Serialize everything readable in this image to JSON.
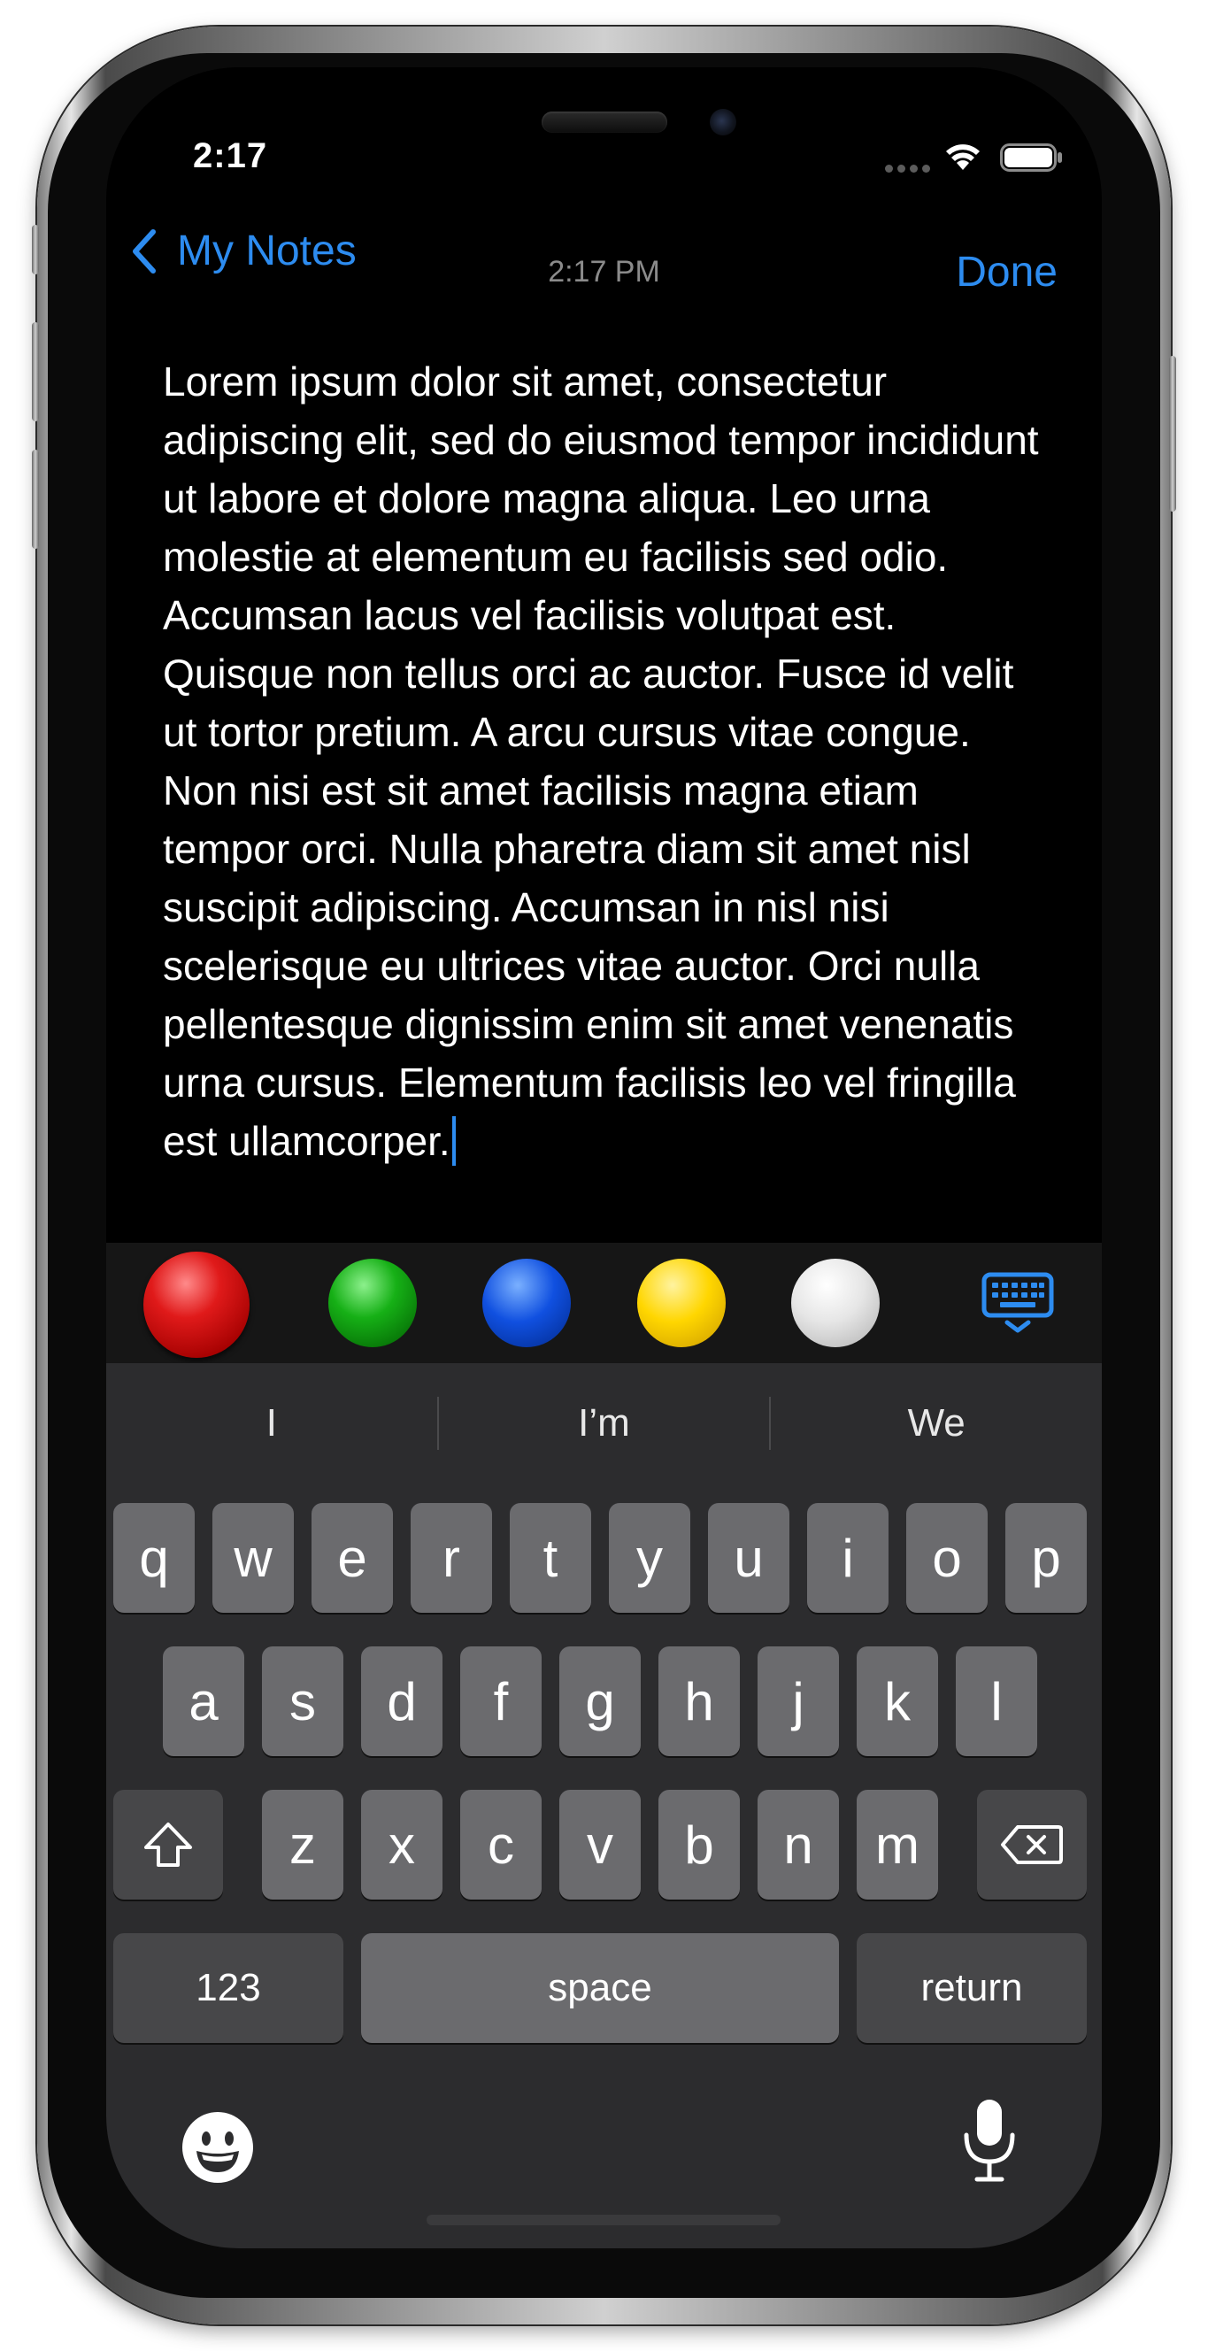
{
  "status_bar": {
    "time": "2:17"
  },
  "nav": {
    "back_label": "My Notes",
    "time": "2:17 PM",
    "done_label": "Done"
  },
  "note": {
    "text": "Lorem ipsum dolor sit amet, consectetur adipiscing elit, sed do eiusmod tempor incididunt ut labore et dolore magna aliqua. Leo urna molestie at elementum eu facilisis sed odio. Accumsan lacus vel facilisis volutpat est. Quisque non tellus orci ac auctor. Fusce id velit ut tortor pretium. A arcu cursus vitae congue. Non nisi est sit amet facilisis magna etiam tempor orci. Nulla pharetra diam sit amet nisl suscipit adipiscing. Accumsan in nisl nisi scelerisque eu ultrices vitae auctor. Orci nulla pellentesque dignissim enim sit amet venenatis urna cursus. Elementum facilisis leo vel fringilla est ullamcorper."
  },
  "toolbar": {
    "colors": [
      {
        "name": "red",
        "hex": "#e01a1a"
      },
      {
        "name": "green",
        "hex": "#16b016"
      },
      {
        "name": "blue",
        "hex": "#1050e0"
      },
      {
        "name": "yellow",
        "hex": "#ffd600"
      },
      {
        "name": "white",
        "hex": "#e6e6e6"
      }
    ],
    "keyboard_icon": "keyboard-dismiss-icon"
  },
  "keyboard": {
    "predictions": [
      "I",
      "I’m",
      "We"
    ],
    "row1": [
      "q",
      "w",
      "e",
      "r",
      "t",
      "y",
      "u",
      "i",
      "o",
      "p"
    ],
    "row2": [
      "a",
      "s",
      "d",
      "f",
      "g",
      "h",
      "j",
      "k",
      "l"
    ],
    "row3": [
      "z",
      "x",
      "c",
      "v",
      "b",
      "n",
      "m"
    ],
    "numbers_label": "123",
    "space_label": "space",
    "return_label": "return",
    "icons": {
      "shift": "shift-icon",
      "delete": "delete-icon",
      "emoji": "emoji-icon",
      "mic": "microphone-icon"
    }
  },
  "colors": {
    "accent": "#2d8cf0",
    "background": "#000000",
    "keyboard_bg": "#2c2c2e",
    "key": "#6b6b6e",
    "key_dark": "#474749"
  }
}
